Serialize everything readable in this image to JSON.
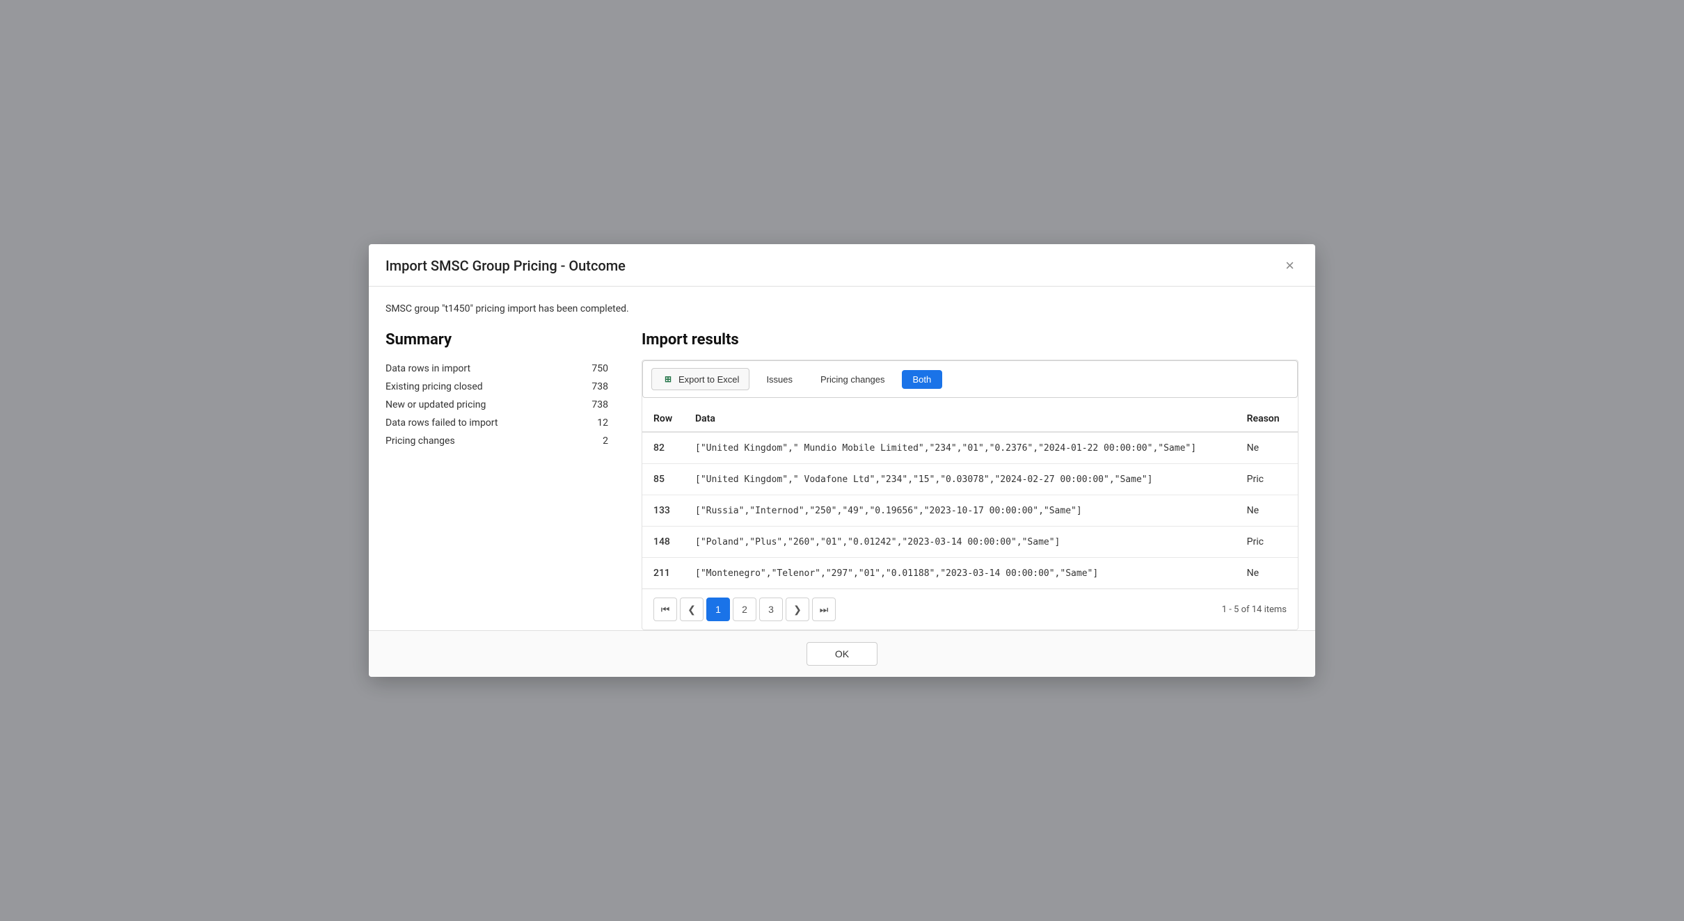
{
  "modal": {
    "title": "Import SMSC Group Pricing - Outcome",
    "close_label": "×"
  },
  "completion_message": "SMSC group \"t1450\" pricing import has been completed.",
  "summary": {
    "title": "Summary",
    "rows": [
      {
        "label": "Data rows in import",
        "value": "750"
      },
      {
        "label": "Existing pricing closed",
        "value": "738"
      },
      {
        "label": "New or updated pricing",
        "value": "738"
      },
      {
        "label": "Data rows failed to import",
        "value": "12"
      },
      {
        "label": "Pricing changes",
        "value": "2"
      }
    ]
  },
  "import_results": {
    "title": "Import results",
    "toolbar": {
      "export_label": "Export to Excel",
      "filter_issues": "Issues",
      "filter_pricing_changes": "Pricing changes",
      "filter_both": "Both"
    },
    "table": {
      "headers": [
        "Row",
        "Data",
        "Reason"
      ],
      "rows": [
        {
          "row": "82",
          "data": "[\"United Kingdom\",\" Mundio Mobile Limited\",\"234\",\"01\",\"0.2376\",\"2024-01-22 00:00:00\",\"Same\"]",
          "reason": "Ne"
        },
        {
          "row": "85",
          "data": "[\"United Kingdom\",\" Vodafone Ltd\",\"234\",\"15\",\"0.03078\",\"2024-02-27 00:00:00\",\"Same\"]",
          "reason": "Pric"
        },
        {
          "row": "133",
          "data": "[\"Russia\",\"Internod\",\"250\",\"49\",\"0.19656\",\"2023-10-17 00:00:00\",\"Same\"]",
          "reason": "Ne"
        },
        {
          "row": "148",
          "data": "[\"Poland\",\"Plus\",\"260\",\"01\",\"0.01242\",\"2023-03-14 00:00:00\",\"Same\"]",
          "reason": "Pric"
        },
        {
          "row": "211",
          "data": "[\"Montenegro\",\"Telenor\",\"297\",\"01\",\"0.01188\",\"2023-03-14 00:00:00\",\"Same\"]",
          "reason": "Ne"
        }
      ]
    },
    "pagination": {
      "pages": [
        "1",
        "2",
        "3"
      ],
      "active_page": "1",
      "info": "1 - 5 of 14 items"
    }
  },
  "footer": {
    "ok_label": "OK"
  }
}
